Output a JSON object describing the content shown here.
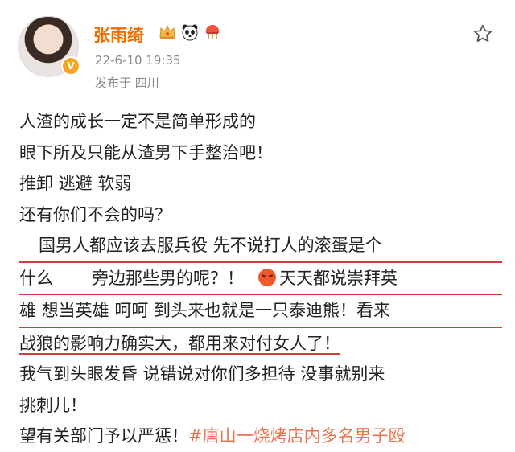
{
  "user": {
    "name": "张雨绮",
    "verified_badge": "V",
    "timestamp": "22-6-10 19:35",
    "location": "发布于 四川",
    "badge_icons": [
      "crown-icon",
      "panda-icon",
      "ornament-icon"
    ]
  },
  "post": {
    "lines": [
      "人渣的成长一定不是简单形成的",
      "眼下所及只能从渣男下手整治吧！",
      "推卸 逃避 软弱",
      "还有你们不会的吗？"
    ],
    "hl1": "国男人都应该去服兵役 先不说打人的滚蛋是个",
    "hl2a": "什么",
    "hl2b": "旁边那些男的呢？！",
    "hl2c": "天天都说崇拜英",
    "hl3": "雄 想当英雄 呵呵 到头来也就是一只泰迪熊！看来",
    "hl4": "战狼的影响力确实大，都用来对付女人了！",
    "line9": "我气到头眼发昏 说错说对你们多担待 没事就别来",
    "line10": "挑刺儿！",
    "line11_text": "望有关部门予以严惩！",
    "line11_tag": "#唐山一烧烤店内多名男子殴"
  },
  "colors": {
    "username": "#f26d00",
    "highlight_underline": "#d43c3c",
    "hashtag": "#eb7350",
    "meta_text": "#8a8a8a"
  }
}
